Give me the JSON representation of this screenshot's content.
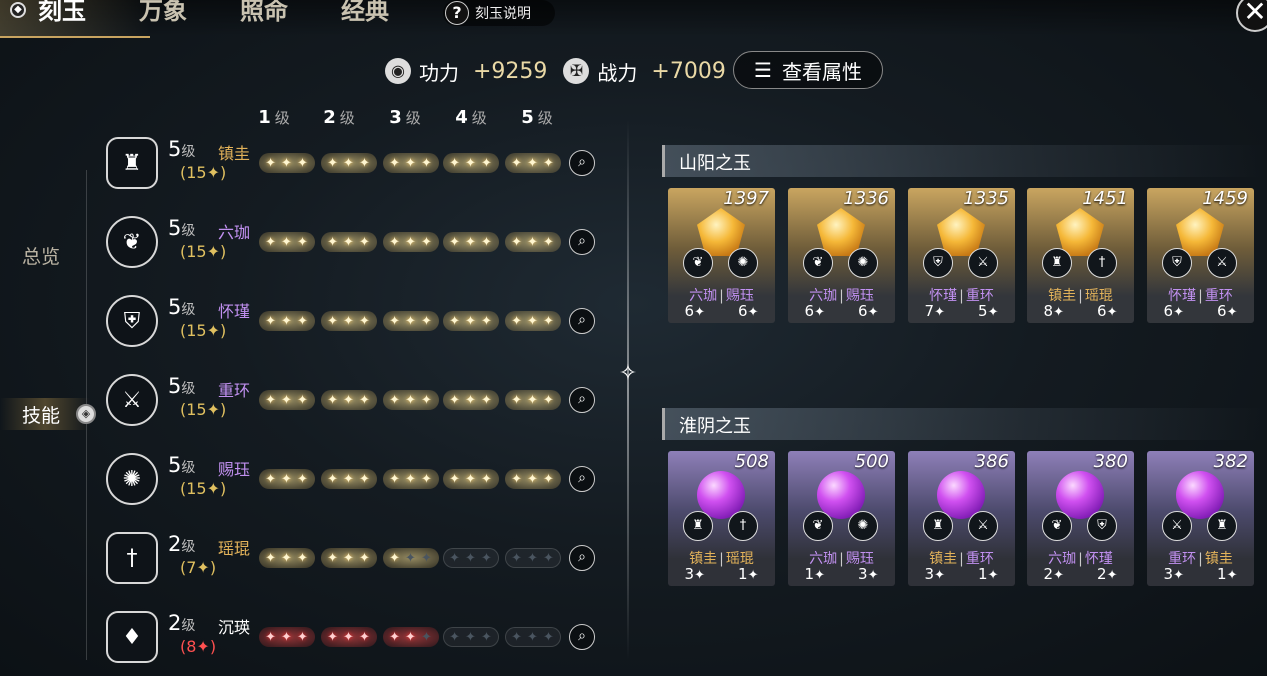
{
  "tabs": [
    "刻玉",
    "万象",
    "照命",
    "经典"
  ],
  "help_label": "刻玉说明",
  "close_label": "✕",
  "stats": {
    "power_label": "功力",
    "power_value": "+9259",
    "combat_label": "战力",
    "combat_value": "+7009",
    "attr_button": "查看属性"
  },
  "nav": {
    "overview": "总览",
    "skill": "技能"
  },
  "level_headers": [
    {
      "num": "1",
      "unit": "级"
    },
    {
      "num": "2",
      "unit": "级"
    },
    {
      "num": "3",
      "unit": "级"
    },
    {
      "num": "4",
      "unit": "级"
    },
    {
      "num": "5",
      "unit": "级"
    }
  ],
  "skills": [
    {
      "level": "5",
      "unit": "级",
      "name": "镇圭",
      "name_color": "#e2b25a",
      "sum": "(15✦)",
      "fill": [
        3,
        3,
        3,
        3,
        3
      ],
      "style": "gold",
      "icon": "tower-icon",
      "glyph": "♜"
    },
    {
      "level": "5",
      "unit": "级",
      "name": "六珈",
      "name_color": "#c190f0",
      "sum": "(15✦)",
      "fill": [
        3,
        3,
        3,
        3,
        3
      ],
      "style": "gold",
      "icon": "sprout-icon",
      "glyph": "❦"
    },
    {
      "level": "5",
      "unit": "级",
      "name": "怀瑾",
      "name_color": "#c190f0",
      "sum": "(15✦)",
      "fill": [
        3,
        3,
        3,
        3,
        3
      ],
      "style": "gold",
      "icon": "shield-icon",
      "glyph": "⛨"
    },
    {
      "level": "5",
      "unit": "级",
      "name": "重环",
      "name_color": "#c190f0",
      "sum": "(15✦)",
      "fill": [
        3,
        3,
        3,
        3,
        3
      ],
      "style": "gold",
      "icon": "sword-burst-icon",
      "glyph": "⚔"
    },
    {
      "level": "5",
      "unit": "级",
      "name": "赐珏",
      "name_color": "#c190f0",
      "sum": "(15✦)",
      "fill": [
        3,
        3,
        3,
        3,
        3
      ],
      "style": "gold",
      "icon": "flame-icon",
      "glyph": "✺"
    },
    {
      "level": "2",
      "unit": "级",
      "name": "瑶琨",
      "name_color": "#e2b25a",
      "sum": "(7✦)",
      "fill": [
        3,
        3,
        1,
        0,
        0
      ],
      "style": "gold",
      "icon": "dagger-icon",
      "glyph": "†"
    },
    {
      "level": "2",
      "unit": "级",
      "name": "沉瑛",
      "name_color": "#ffffff",
      "sum": "(8✦)",
      "fill": [
        3,
        3,
        2,
        0,
        0
      ],
      "style": "red",
      "icon": "drop-icon",
      "glyph": "♦"
    }
  ],
  "sections": [
    {
      "title": "山阳之玉",
      "type": "gold",
      "cards": [
        {
          "score": "1397",
          "names": [
            "六珈",
            "赐珏"
          ],
          "colors": [
            "#c190f0",
            "#c190f0"
          ],
          "vals": [
            "6",
            "6"
          ],
          "icons": [
            "sprout-icon",
            "flame-icon"
          ],
          "glyphs": [
            "❦",
            "✺"
          ]
        },
        {
          "score": "1336",
          "names": [
            "六珈",
            "赐珏"
          ],
          "colors": [
            "#c190f0",
            "#c190f0"
          ],
          "vals": [
            "6",
            "6"
          ],
          "icons": [
            "sprout-icon",
            "flame-icon"
          ],
          "glyphs": [
            "❦",
            "✺"
          ]
        },
        {
          "score": "1335",
          "names": [
            "怀瑾",
            "重环"
          ],
          "colors": [
            "#c190f0",
            "#c190f0"
          ],
          "vals": [
            "7",
            "5"
          ],
          "icons": [
            "shield-icon",
            "sword-burst-icon"
          ],
          "glyphs": [
            "⛨",
            "⚔"
          ]
        },
        {
          "score": "1451",
          "names": [
            "镇圭",
            "瑶琨"
          ],
          "colors": [
            "#e2b25a",
            "#e2b25a"
          ],
          "vals": [
            "8",
            "6"
          ],
          "icons": [
            "tower-icon",
            "dagger-icon"
          ],
          "glyphs": [
            "♜",
            "†"
          ]
        },
        {
          "score": "1459",
          "names": [
            "怀瑾",
            "重环"
          ],
          "colors": [
            "#c190f0",
            "#c190f0"
          ],
          "vals": [
            "6",
            "6"
          ],
          "icons": [
            "shield-icon",
            "sword-burst-icon"
          ],
          "glyphs": [
            "⛨",
            "⚔"
          ]
        }
      ]
    },
    {
      "title": "淮阴之玉",
      "type": "purple",
      "cards": [
        {
          "score": "508",
          "names": [
            "镇圭",
            "瑶琨"
          ],
          "colors": [
            "#e2b25a",
            "#e2b25a"
          ],
          "vals": [
            "3",
            "1"
          ],
          "icons": [
            "tower-icon",
            "dagger-icon"
          ],
          "glyphs": [
            "♜",
            "†"
          ]
        },
        {
          "score": "500",
          "names": [
            "六珈",
            "赐珏"
          ],
          "colors": [
            "#c190f0",
            "#c190f0"
          ],
          "vals": [
            "1",
            "3"
          ],
          "icons": [
            "sprout-icon",
            "flame-icon"
          ],
          "glyphs": [
            "❦",
            "✺"
          ]
        },
        {
          "score": "386",
          "names": [
            "镇圭",
            "重环"
          ],
          "colors": [
            "#e2b25a",
            "#c190f0"
          ],
          "vals": [
            "3",
            "1"
          ],
          "icons": [
            "tower-icon",
            "sword-burst-icon"
          ],
          "glyphs": [
            "♜",
            "⚔"
          ]
        },
        {
          "score": "380",
          "names": [
            "六珈",
            "怀瑾"
          ],
          "colors": [
            "#c190f0",
            "#c190f0"
          ],
          "vals": [
            "2",
            "2"
          ],
          "icons": [
            "sprout-icon",
            "shield-icon"
          ],
          "glyphs": [
            "❦",
            "⛨"
          ]
        },
        {
          "score": "382",
          "names": [
            "重环",
            "镇圭"
          ],
          "colors": [
            "#c190f0",
            "#e2b25a"
          ],
          "vals": [
            "3",
            "1"
          ],
          "icons": [
            "sword-burst-icon",
            "tower-icon"
          ],
          "glyphs": [
            "⚔",
            "♜"
          ]
        }
      ]
    }
  ],
  "star_glyph": "✦",
  "search_glyph": "🔍︎"
}
